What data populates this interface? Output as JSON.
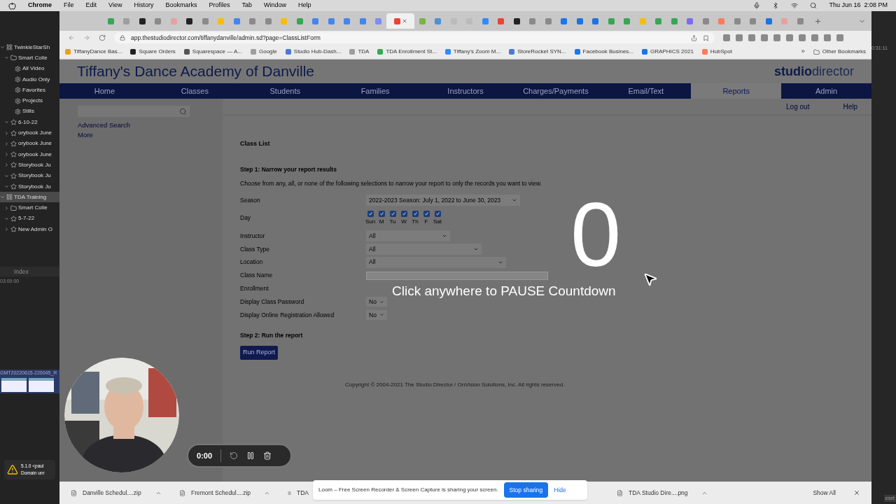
{
  "menubar": {
    "app": "Chrome",
    "items": [
      "File",
      "Edit",
      "View",
      "History",
      "Bookmarks",
      "Profiles",
      "Tab",
      "Window",
      "Help"
    ],
    "clock": "Thu Jun 16  2:08 PM"
  },
  "library": {
    "tree": [
      {
        "label": "TwinkleStarSh",
        "kind": "library",
        "expanded": true,
        "selected": false,
        "children": [
          {
            "label": "Smart Colle",
            "kind": "folder",
            "expanded": true,
            "selected": false,
            "children": [
              {
                "label": "All Video",
                "kind": "smart",
                "selected": false
              },
              {
                "label": "Audio Only",
                "kind": "smart",
                "selected": false
              },
              {
                "label": "Favorites",
                "kind": "smart",
                "selected": false
              },
              {
                "label": "Projects",
                "kind": "smart",
                "selected": false
              },
              {
                "label": "Stills",
                "kind": "smart",
                "selected": false
              }
            ]
          },
          {
            "label": "6-10-22",
            "kind": "event",
            "expanded": true,
            "selected": false
          },
          {
            "label": "orybook June",
            "kind": "event",
            "expanded": false,
            "selected": false
          },
          {
            "label": "orybook June",
            "kind": "event",
            "expanded": false,
            "selected": false
          },
          {
            "label": "orybook June",
            "kind": "event",
            "expanded": false,
            "selected": false
          },
          {
            "label": "Storybook Ju",
            "kind": "event",
            "expanded": false,
            "selected": false
          },
          {
            "label": "Storybook Ju",
            "kind": "event",
            "expanded": true,
            "selected": false
          },
          {
            "label": "Storybook Ju",
            "kind": "event",
            "expanded": true,
            "selected": false
          }
        ]
      },
      {
        "label": "TDA Training",
        "kind": "library",
        "expanded": true,
        "selected": true,
        "children": [
          {
            "label": "Smart Colle",
            "kind": "folder",
            "expanded": false,
            "selected": false
          },
          {
            "label": "5-7-22",
            "kind": "event",
            "expanded": true,
            "selected": false
          },
          {
            "label": "New Admin O",
            "kind": "event",
            "expanded": false,
            "selected": false
          }
        ]
      }
    ],
    "index_tab": "Index",
    "timecode": "03:00:00",
    "clip": "GMT20220615-220045_R",
    "alert": {
      "version": "5.1.0 <paul",
      "message": "Domain unr"
    }
  },
  "right_strip": {
    "timecode": "0:31:11",
    "button": "eset"
  },
  "browser": {
    "tabs": [
      {
        "color": "#34a853",
        "selected": false
      },
      {
        "color": "#9e9e9e",
        "selected": false
      },
      {
        "color": "#222222",
        "selected": false
      },
      {
        "color": "#8a8a8a",
        "selected": false
      },
      {
        "color": "#e8a0a0",
        "selected": false
      },
      {
        "color": "#222222",
        "selected": false
      },
      {
        "color": "#8a8a8a",
        "selected": false
      },
      {
        "color": "#fbbc04",
        "selected": false
      },
      {
        "color": "#4285f4",
        "selected": false
      },
      {
        "color": "#8a8a8a",
        "selected": false
      },
      {
        "color": "#8a8a8a",
        "selected": false
      },
      {
        "color": "#fbbc04",
        "selected": false
      },
      {
        "color": "#34a853",
        "selected": false
      },
      {
        "color": "#4285f4",
        "selected": false
      },
      {
        "color": "#4285f4",
        "selected": false
      },
      {
        "color": "#4285f4",
        "selected": false
      },
      {
        "color": "#4285f4",
        "selected": false
      },
      {
        "color": "#7b8cff",
        "selected": false
      },
      {
        "color": "#ea4335",
        "selected": true
      },
      {
        "color": "#7cb342",
        "selected": false
      },
      {
        "color": "#4a90d9",
        "selected": false
      },
      {
        "color": "#bbbbbb",
        "selected": false
      },
      {
        "color": "#bbbbbb",
        "selected": false
      },
      {
        "color": "#2d8cff",
        "selected": false
      },
      {
        "color": "#ea4335",
        "selected": false
      },
      {
        "color": "#222222",
        "selected": false
      },
      {
        "color": "#8a8a8a",
        "selected": false
      },
      {
        "color": "#8a8a8a",
        "selected": false
      },
      {
        "color": "#1877f2",
        "selected": false
      },
      {
        "color": "#1a73e8",
        "selected": false
      },
      {
        "color": "#1a73e8",
        "selected": false
      },
      {
        "color": "#34a853",
        "selected": false
      },
      {
        "color": "#34a853",
        "selected": false
      },
      {
        "color": "#fbbc04",
        "selected": false
      },
      {
        "color": "#34a853",
        "selected": false
      },
      {
        "color": "#34a853",
        "selected": false
      },
      {
        "color": "#7b6cf6",
        "selected": false
      },
      {
        "color": "#8a8a8a",
        "selected": false
      },
      {
        "color": "#ff7a59",
        "selected": false
      },
      {
        "color": "#8a8a8a",
        "selected": false
      },
      {
        "color": "#8a8a8a",
        "selected": false
      },
      {
        "color": "#1a73e8",
        "selected": false
      },
      {
        "color": "#e8a0a0",
        "selected": false
      },
      {
        "color": "#8a8a8a",
        "selected": false
      }
    ],
    "url": "app.thestudiodirector.com/tiffanydanville/admin.sd?page=ClassListForm",
    "bookmarks": [
      {
        "label": "TiffanyDance Bas...",
        "color": "#e8a020"
      },
      {
        "label": "Square Orders",
        "color": "#222222"
      },
      {
        "label": "Squarespace — A...",
        "color": "#555555"
      },
      {
        "label": "Google",
        "color": "#9e9e9e"
      },
      {
        "label": "Studio Hub-Dash...",
        "color": "#4a7bd0"
      },
      {
        "label": "TDA",
        "color": "#9e9e9e"
      },
      {
        "label": "TDA Enrollment St...",
        "color": "#34a853"
      },
      {
        "label": "Tiffany's Zoom M...",
        "color": "#2d8cff"
      },
      {
        "label": "StoreRocket SYN...",
        "color": "#4a7bd0"
      },
      {
        "label": "Facebook Busines...",
        "color": "#1877f2"
      },
      {
        "label": "GRAPHICS 2021",
        "color": "#1a73e8"
      },
      {
        "label": "HubSpot",
        "color": "#ff7a59"
      }
    ],
    "more_bookmarks": "»",
    "other_bookmarks": "Other Bookmarks",
    "downloads": [
      {
        "label": "Danville Schedul....zip"
      },
      {
        "label": "Fremont Schedul....zip"
      },
      {
        "label": "TDA"
      },
      {
        "label": "TDA Studio Dire....png"
      }
    ],
    "show_all": "Show All"
  },
  "page": {
    "title": "Tiffany's Dance Academy of Danville",
    "logo": {
      "bold": "studio",
      "light": "director"
    },
    "nav": [
      {
        "label": "Home",
        "selected": false
      },
      {
        "label": "Classes",
        "selected": false
      },
      {
        "label": "Students",
        "selected": false
      },
      {
        "label": "Families",
        "selected": false
      },
      {
        "label": "Instructors",
        "selected": false
      },
      {
        "label": "Charges/Payments",
        "selected": false
      },
      {
        "label": "Email/Text",
        "selected": false
      },
      {
        "label": "Reports",
        "selected": true
      },
      {
        "label": "Admin",
        "selected": false
      }
    ],
    "top_links": [
      "Log out",
      "Help"
    ],
    "side_links": [
      "Advanced Search",
      "More"
    ],
    "heading": "Class List",
    "step1": "Step 1: Narrow your report results",
    "intro": "Choose from any, all, or none of the following selections to narrow your report to only the records you want to view.",
    "fields": [
      {
        "label": "Season",
        "kind": "select",
        "value": "2022-2023 Season: July 1, 2022 to June 30, 2023"
      },
      {
        "label": "Day",
        "kind": "days",
        "days": [
          {
            "label": "Sun",
            "checked": true
          },
          {
            "label": "M",
            "checked": true
          },
          {
            "label": "Tu",
            "checked": true
          },
          {
            "label": "W",
            "checked": true
          },
          {
            "label": "Th",
            "checked": true
          },
          {
            "label": "F",
            "checked": true
          },
          {
            "label": "Sat",
            "checked": true
          }
        ]
      },
      {
        "label": "Instructor",
        "kind": "select",
        "value": "All"
      },
      {
        "label": "Class Type",
        "kind": "select",
        "value": "All"
      },
      {
        "label": "Location",
        "kind": "select",
        "value": "All"
      },
      {
        "label": "Class Name",
        "kind": "text"
      },
      {
        "label": "Enrollment",
        "kind": "hidden"
      },
      {
        "label": "Display Class Password",
        "kind": "small_select",
        "value": "No"
      },
      {
        "label": "Display Online Registration Allowed",
        "kind": "small_select",
        "value": "No"
      }
    ],
    "step2": "Step 2: Run the report",
    "run_button": "Run Report",
    "copyright": "Copyright © 2004-2021 The Studio Director / OnVision Solutions, Inc. All rights reserved."
  },
  "countdown": {
    "number": "0",
    "hint": "Click anywhere to PAUSE Countdown"
  },
  "recorder": {
    "time": "0:00"
  },
  "sharing_banner": {
    "message": "Loom – Free Screen Recorder & Screen Capture is sharing your screen.",
    "stop": "Stop sharing",
    "hide": "Hide"
  }
}
